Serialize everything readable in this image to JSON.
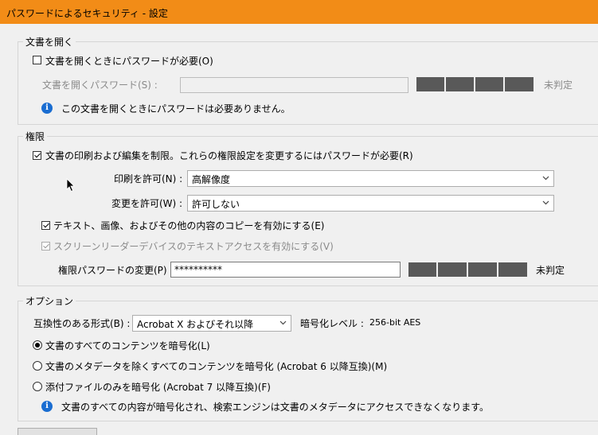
{
  "window": {
    "title": "パスワードによるセキュリティ - 設定",
    "titlebar_color": "#f28c17"
  },
  "open_section": {
    "legend": "文書を開く",
    "require_label": "文書を開くときにパスワードが必要(O)",
    "require_checked": false,
    "password_label": "文書を開くパスワード(S) :",
    "password_value": "",
    "strength_label": "未判定",
    "info_text": "この文書を開くときにパスワードは必要ありません。"
  },
  "permissions_section": {
    "legend": "権限",
    "restrict_label": "文書の印刷および編集を制限。これらの権限設定を変更するにはパスワードが必要(R)",
    "restrict_checked": true,
    "print_label": "印刷を許可(N) :",
    "print_value": "高解像度",
    "change_label": "変更を許可(W) :",
    "change_value": "許可しない",
    "copy_label": "テキスト、画像、およびその他の内容のコピーを有効にする(E)",
    "copy_checked": true,
    "reader_label": "スクリーンリーダーデバイスのテキストアクセスを有効にする(V)",
    "reader_checked": true,
    "perm_password_label": "権限パスワードの変更(P) :",
    "perm_password_value": "**********",
    "strength_label": "未判定"
  },
  "options_section": {
    "legend": "オプション",
    "compat_label": "互換性のある形式(B) :",
    "compat_value": "Acrobat X およびそれ以降",
    "encryption_level_label": "暗号化レベル :",
    "encryption_level_value": "256-bit AES",
    "radio_all_label": "文書のすべてのコンテンツを暗号化(L)",
    "radio_except_meta_label": "文書のメタデータを除くすべてのコンテンツを暗号化 (Acrobat 6 以降互換)(M)",
    "radio_attach_label": "添付ファイルのみを暗号化 (Acrobat 7 以降互換)(F)",
    "selected_radio": "all",
    "info_text": "文書のすべての内容が暗号化され、検索エンジンは文書のメタデータにアクセスできなくなります。"
  },
  "icons": {
    "info": "info-icon",
    "dropdown": "chevron-down-icon",
    "cursor": "mouse-pointer-icon"
  }
}
